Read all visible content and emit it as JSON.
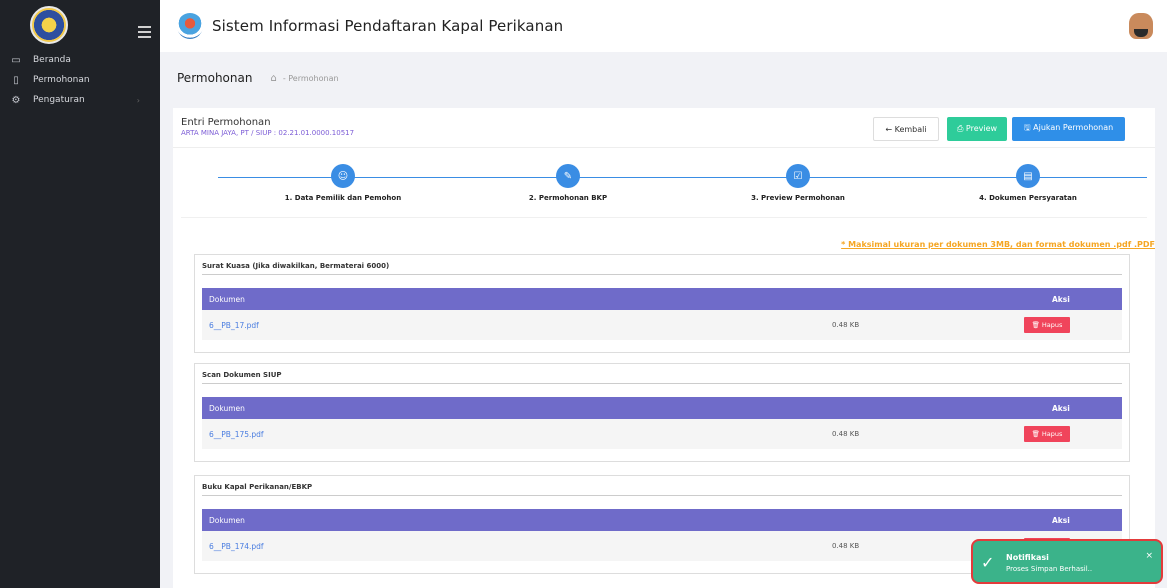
{
  "sidebar": {
    "items": [
      {
        "label": "Beranda",
        "icon": "monitor-icon"
      },
      {
        "label": "Permohonan",
        "icon": "document-icon"
      },
      {
        "label": "Pengaturan",
        "icon": "gear-icon"
      }
    ]
  },
  "header": {
    "title": "Sistem Informasi Pendaftaran Kapal Perikanan"
  },
  "breadcrumb": {
    "title": "Permohonan",
    "path": "- Permohonan"
  },
  "card": {
    "title": "Entri Permohonan",
    "subtitle": "ARTA MINA JAYA, PT / SIUP : 02.21.01.0000.10517",
    "back_label": "← Kembali",
    "preview_label": "⎙ Preview",
    "submit_label": "🖫 Ajukan Permohonan"
  },
  "steps": [
    {
      "label": "1. Data Pemilik dan Pemohon",
      "icon": "user-icon"
    },
    {
      "label": "2. Permohonan BKP",
      "icon": "pencil-icon"
    },
    {
      "label": "3. Preview Permohonan",
      "icon": "checklist-icon"
    },
    {
      "label": "4. Dokumen Persyaratan",
      "icon": "file-icon"
    }
  ],
  "note": "* Maksimal ukuran per dokumen 3MB, dan format dokumen .pdf .PDF",
  "table_headers": {
    "dokumen": "Dokumen",
    "aksi": "Aksi"
  },
  "delete_label": "🗑 Hapus",
  "documents": [
    {
      "title": "Surat Kuasa (Jika diwakilkan, Bermaterai 6000)",
      "file": "6__PB_17.pdf",
      "size": "0.48 KB"
    },
    {
      "title": "Scan Dokumen SIUP",
      "file": "6__PB_175.pdf",
      "size": "0.48 KB"
    },
    {
      "title": "Buku Kapal Perikanan/EBKP",
      "file": "6__PB_174.pdf",
      "size": "0.48 KB"
    }
  ],
  "toast": {
    "title": "Notifikasi",
    "message": "Proses Simpan Berhasil..",
    "close": "×"
  },
  "colors": {
    "sidebar": "#1f2227",
    "accent": "#3a8de4",
    "table_header": "#6f6bc9",
    "danger": "#f0445b",
    "success": "#3bb38a"
  }
}
